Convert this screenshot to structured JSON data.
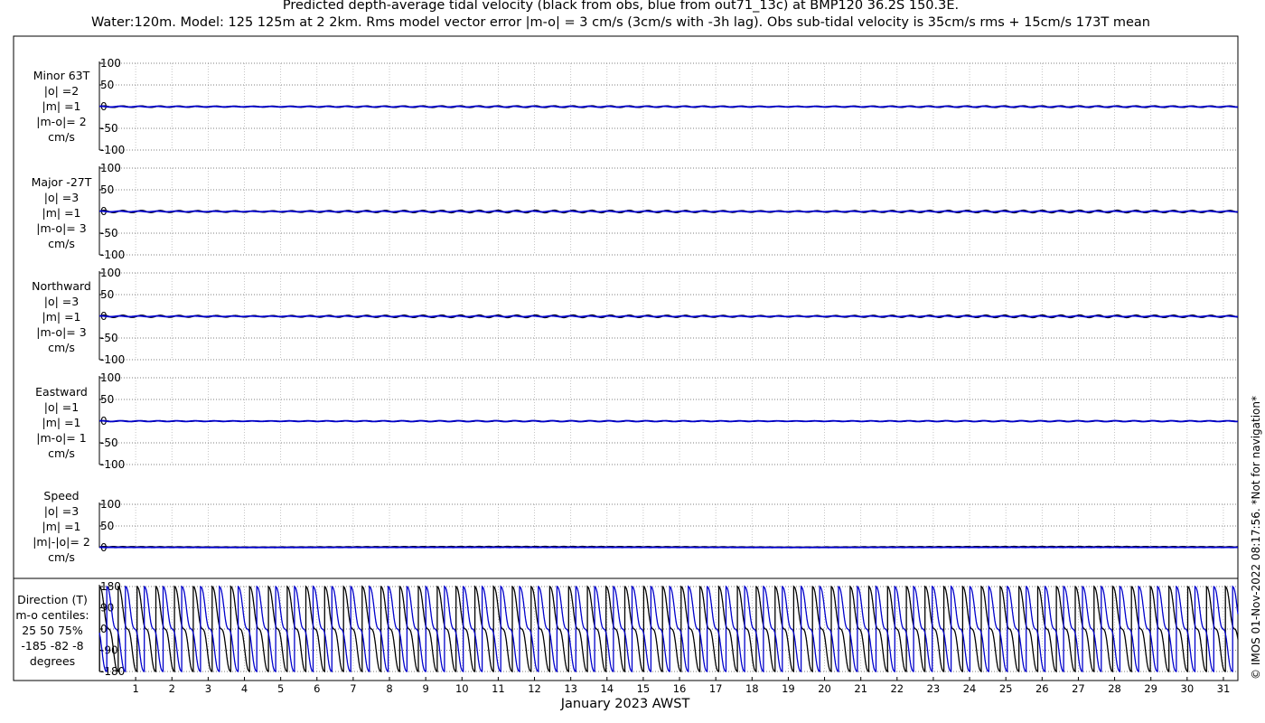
{
  "title_lines": [
    "Predicted depth-average tidal velocity (black from obs, blue from out71_13c) at BMP120 36.2S 150.3E.",
    "Water:120m. Model: 125 125m at 2 2km. Rms model vector error |m-o| = 3 cm/s (3cm/s with -3h lag). Obs sub-tidal velocity is 35cm/s rms + 15cm/s 173T mean"
  ],
  "copyright": "© IMOS 01-Nov-2022 08:17:56. *Not for navigation*",
  "colors": {
    "obs": "#000000",
    "model": "#0000cc",
    "grid": "#b8b8b8"
  },
  "chart_data": {
    "type": "line",
    "xlabel": "January 2023 AWST",
    "xlim": [
      0,
      31.4
    ],
    "x_ticks": [
      1,
      2,
      3,
      4,
      5,
      6,
      7,
      8,
      9,
      10,
      11,
      12,
      13,
      14,
      15,
      16,
      17,
      18,
      19,
      20,
      21,
      22,
      23,
      24,
      25,
      26,
      27,
      28,
      29,
      30,
      31
    ],
    "series_names": [
      "obs",
      "out71_13c"
    ],
    "panels": [
      {
        "id": "minor",
        "label_lines": [
          "Minor 63T",
          "|o| =2",
          "|m| =1",
          "|m-o|= 2",
          "cm/s"
        ],
        "ylim": [
          -100,
          100
        ],
        "yticks": [
          100,
          50,
          0,
          -50,
          -100
        ],
        "obs_amplitude": 2,
        "model_amplitude": 1
      },
      {
        "id": "major",
        "label_lines": [
          "Major -27T",
          "|o| =3",
          "|m| =1",
          "|m-o|= 3",
          "cm/s"
        ],
        "ylim": [
          -100,
          100
        ],
        "yticks": [
          100,
          50,
          0,
          -50,
          -100
        ],
        "obs_amplitude": 3,
        "model_amplitude": 1
      },
      {
        "id": "northward",
        "label_lines": [
          "Northward",
          "|o| =3",
          "|m| =1",
          "|m-o|= 3",
          "cm/s"
        ],
        "ylim": [
          -100,
          100
        ],
        "yticks": [
          100,
          50,
          0,
          -50,
          -100
        ],
        "obs_amplitude": 3,
        "model_amplitude": 1
      },
      {
        "id": "eastward",
        "label_lines": [
          "Eastward",
          "|o| =1",
          "|m| =1",
          "|m-o|= 1",
          "cm/s"
        ],
        "ylim": [
          -100,
          100
        ],
        "yticks": [
          100,
          50,
          0,
          -50,
          -100
        ],
        "obs_amplitude": 1,
        "model_amplitude": 1
      },
      {
        "id": "speed",
        "label_lines": [
          "Speed",
          "|o| =3",
          "|m| =1",
          "|m|-|o|= 2",
          "cm/s"
        ],
        "ylim": [
          0,
          100
        ],
        "yticks": [
          100,
          50,
          0
        ],
        "obs_amplitude": 3,
        "model_amplitude": 1
      },
      {
        "id": "direction",
        "label_lines": [
          "Direction (T)",
          "m-o centiles:",
          "25  50  75%",
          "-185  -82   -8",
          "degrees"
        ],
        "ylim": [
          -180,
          180
        ],
        "yticks": [
          180,
          90,
          0,
          -90,
          -180
        ],
        "tidal_period_days": 0.5175,
        "model_phase_lag_days": 0.2
      }
    ]
  }
}
